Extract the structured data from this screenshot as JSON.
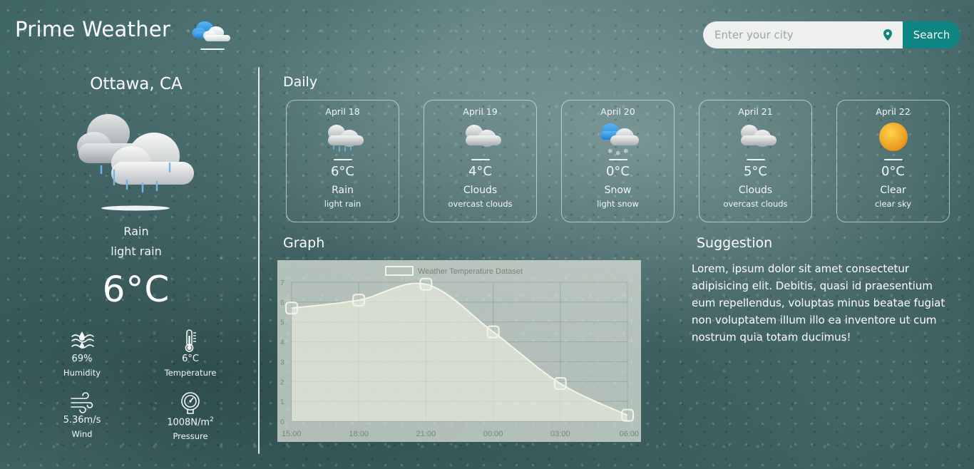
{
  "brand": {
    "title": "Prime Weather"
  },
  "search": {
    "placeholder": "Enter your city",
    "button_label": "Search"
  },
  "current": {
    "location": "Ottawa, CA",
    "condition": "Rain",
    "description": "light rain",
    "temperature": "6°C",
    "stats": [
      {
        "value": "69%",
        "label": "Humidity",
        "icon": "humidity-icon"
      },
      {
        "value": "6°C",
        "label": "Temperature",
        "icon": "thermometer-icon"
      },
      {
        "value": "5.36m/s",
        "label": "Wind",
        "icon": "wind-icon"
      },
      {
        "value": "1008N/m",
        "value_sup": "2",
        "label": "Pressure",
        "icon": "pressure-gauge-icon"
      }
    ]
  },
  "daily": {
    "title": "Daily",
    "days": [
      {
        "date": "April 18",
        "temp": "6°C",
        "condition": "Rain",
        "description": "light rain",
        "icon": "rain-icon"
      },
      {
        "date": "April 19",
        "temp": "4°C",
        "condition": "Clouds",
        "description": "overcast clouds",
        "icon": "clouds-icon"
      },
      {
        "date": "April 20",
        "temp": "0°C",
        "condition": "Snow",
        "description": "light snow",
        "icon": "snow-icon"
      },
      {
        "date": "April 21",
        "temp": "5°C",
        "condition": "Clouds",
        "description": "overcast clouds",
        "icon": "clouds-icon"
      },
      {
        "date": "April 22",
        "temp": "0°C",
        "condition": "Clear",
        "description": "clear sky",
        "icon": "sun-icon"
      }
    ]
  },
  "graph": {
    "title": "Graph"
  },
  "chart_data": {
    "type": "line",
    "legend": "Weather Temperature Dataset",
    "legend_position": "top",
    "categories": [
      "15:00",
      "18:00",
      "21:00",
      "00:00",
      "03:00",
      "06:00"
    ],
    "series": [
      {
        "name": "Weather Temperature Dataset",
        "values": [
          5.7,
          6.1,
          6.9,
          4.5,
          1.9,
          0.3
        ]
      }
    ],
    "ylim": [
      0,
      7
    ],
    "yticks": [
      0,
      1,
      2,
      3,
      4,
      5,
      6,
      7
    ],
    "grid": true,
    "fill": true,
    "colors": {
      "line": "#f4f4e6",
      "fill": "#f4f4e6"
    }
  },
  "suggestion": {
    "title": "Suggestion",
    "text": "Lorem, ipsum dolor sit amet consectetur adipisicing elit. Debitis, quasi id praesentium eum repellendus, voluptas minus beatae fugiat non voluptatem illum illo ea inventore ut cum nostrum quia totam ducimus!"
  },
  "colors": {
    "accent": "#0f8583",
    "search_bg": "#eef0ef"
  }
}
